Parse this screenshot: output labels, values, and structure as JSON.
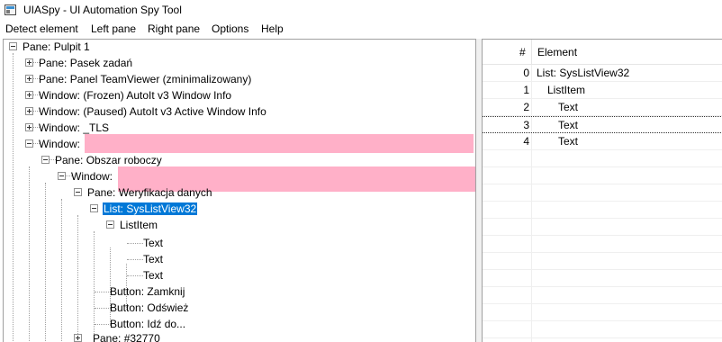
{
  "window": {
    "title": "UIASpy - UI Automation Spy Tool",
    "icon": "app-window-icon"
  },
  "menu": [
    "Detect element",
    "Left pane",
    "Right pane",
    "Options",
    "Help"
  ],
  "tree": {
    "nodes": [
      {
        "label": "Pane: Pulpit 1",
        "expander": "minus"
      },
      {
        "label": "Pane: Pasek zadań",
        "expander": "plus"
      },
      {
        "label": "Pane: Panel TeamViewer (zminimalizowany)",
        "expander": "plus"
      },
      {
        "label": "Window: (Frozen) AutoIt v3 Window Info",
        "expander": "plus"
      },
      {
        "label": "Window: (Paused) AutoIt v3 Active Window Info",
        "expander": "plus"
      },
      {
        "label": "Window: _TLS",
        "expander": "plus"
      },
      {
        "label": "Window:",
        "expander": "minus",
        "redacted": true
      },
      {
        "label": "Pane: Obszar roboczy",
        "expander": "minus"
      },
      {
        "label": "Window:",
        "expander": "minus",
        "redacted": true
      },
      {
        "label": "Pane: Weryfikacja danych",
        "expander": "minus"
      },
      {
        "label": "List: SysListView32",
        "expander": "minus",
        "selected": true
      },
      {
        "label": "ListItem",
        "expander": "minus"
      },
      {
        "label": "Text",
        "expander": "none"
      },
      {
        "label": "Text",
        "expander": "none"
      },
      {
        "label": "Text",
        "expander": "none"
      },
      {
        "label": "Button: Zamknij",
        "expander": "none"
      },
      {
        "label": "Button: Odśwież",
        "expander": "none"
      },
      {
        "label": "Button: Idź do...",
        "expander": "none"
      },
      {
        "label": "Pane: #32770",
        "expander": "plus"
      }
    ]
  },
  "details": {
    "columns": [
      "#",
      "Element"
    ],
    "rows": [
      {
        "num": "0",
        "element": "List: SysListView32"
      },
      {
        "num": "1",
        "element": "ListItem"
      },
      {
        "num": "2",
        "element": "Text"
      },
      {
        "num": "3",
        "element": "Text",
        "focused": true
      },
      {
        "num": "4",
        "element": "Text"
      }
    ]
  },
  "colors": {
    "selection": "#0078d7",
    "redaction": "#ffb0c8"
  }
}
